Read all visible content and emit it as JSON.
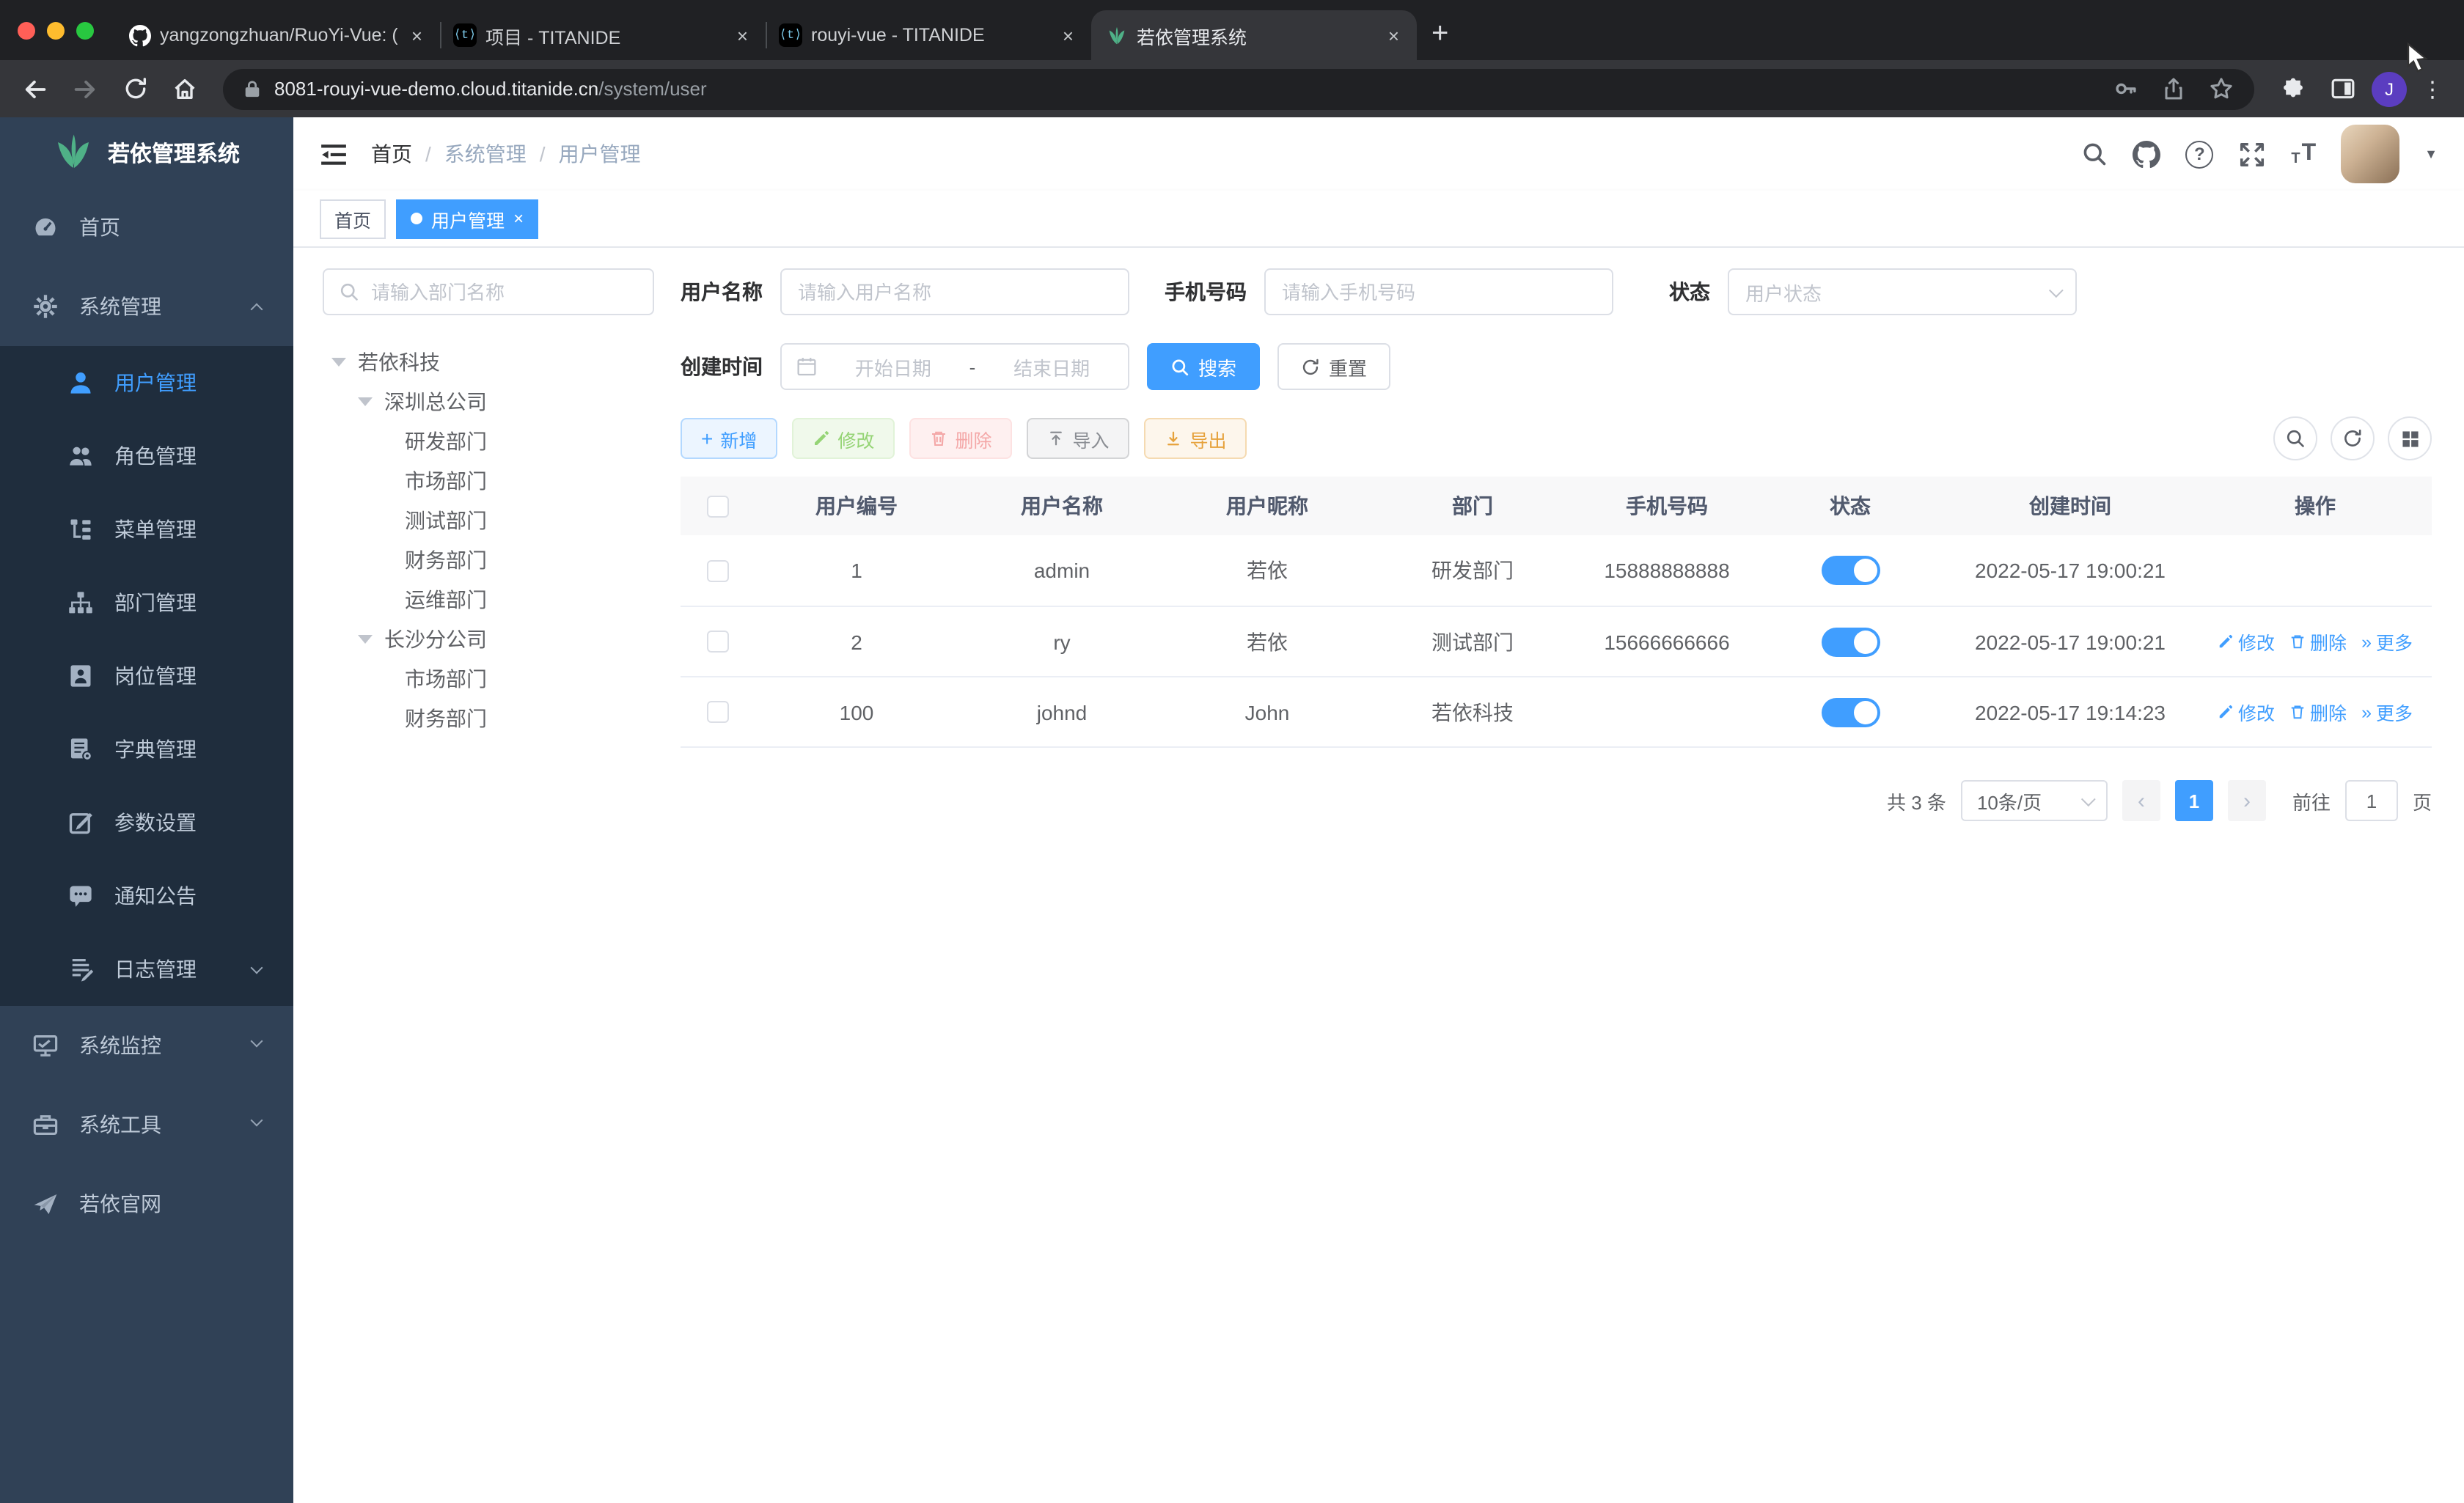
{
  "browser": {
    "tabs": [
      {
        "title": "yangzongzhuan/RuoYi-Vue: (Ru"
      },
      {
        "title": "项目 - TITANIDE"
      },
      {
        "title": "rouyi-vue - TITANIDE"
      },
      {
        "title": "若依管理系统"
      }
    ],
    "titanide_glyph": "⟨t⟩",
    "url_host": "8081-rouyi-vue-demo.cloud.titanide.cn",
    "url_path": "/system/user",
    "profile_initial": "J"
  },
  "icons": {
    "sep": "/",
    "close": "×",
    "plus": "+",
    "kebab": "⋮",
    "more": "»",
    "prev": "‹",
    "next": "›",
    "caret": "▼",
    "question": "?"
  },
  "sidebar": {
    "logo_title": "若依管理系统",
    "items": [
      {
        "label": "首页"
      },
      {
        "label": "系统管理"
      },
      {
        "label": "用户管理"
      },
      {
        "label": "角色管理"
      },
      {
        "label": "菜单管理"
      },
      {
        "label": "部门管理"
      },
      {
        "label": "岗位管理"
      },
      {
        "label": "字典管理"
      },
      {
        "label": "参数设置"
      },
      {
        "label": "通知公告"
      },
      {
        "label": "日志管理"
      },
      {
        "label": "系统监控"
      },
      {
        "label": "系统工具"
      },
      {
        "label": "若依官网"
      }
    ]
  },
  "navbar": {
    "breadcrumb": [
      "首页",
      "系统管理",
      "用户管理"
    ]
  },
  "tags": [
    {
      "label": "首页"
    },
    {
      "label": "用户管理"
    }
  ],
  "tree": {
    "search_placeholder": "请输入部门名称",
    "nodes": [
      {
        "label": "若依科技"
      },
      {
        "label": "深圳总公司"
      },
      {
        "label": "研发部门"
      },
      {
        "label": "市场部门"
      },
      {
        "label": "测试部门"
      },
      {
        "label": "财务部门"
      },
      {
        "label": "运维部门"
      },
      {
        "label": "长沙分公司"
      },
      {
        "label": "市场部门"
      },
      {
        "label": "财务部门"
      }
    ]
  },
  "filters": {
    "username_label": "用户名称",
    "username_placeholder": "请输入用户名称",
    "phone_label": "手机号码",
    "phone_placeholder": "请输入手机号码",
    "status_label": "状态",
    "status_placeholder": "用户状态",
    "created_label": "创建时间",
    "date_start": "开始日期",
    "date_separator": "-",
    "date_end": "结束日期",
    "search_label": "搜索",
    "reset_label": "重置"
  },
  "toolbar": {
    "add": "新增",
    "edit": "修改",
    "delete": "删除",
    "import": "导入",
    "export": "导出"
  },
  "table": {
    "headers": [
      "用户编号",
      "用户名称",
      "用户昵称",
      "部门",
      "手机号码",
      "状态",
      "创建时间",
      "操作"
    ],
    "actions": {
      "edit": "修改",
      "delete": "删除",
      "more": "更多"
    },
    "rows": [
      {
        "id": "1",
        "username": "admin",
        "nickname": "若依",
        "dept": "研发部门",
        "phone": "15888888888",
        "created": "2022-05-17 19:00:21"
      },
      {
        "id": "2",
        "username": "ry",
        "nickname": "若依",
        "dept": "测试部门",
        "phone": "15666666666",
        "created": "2022-05-17 19:00:21"
      },
      {
        "id": "100",
        "username": "johnd",
        "nickname": "John",
        "dept": "若依科技",
        "phone": "",
        "created": "2022-05-17 19:14:23"
      }
    ]
  },
  "pagination": {
    "total_text": "共 3 条",
    "page_size": "10条/页",
    "current_page": "1",
    "goto_label": "前往",
    "goto_value": "1",
    "unit_label": "页"
  }
}
